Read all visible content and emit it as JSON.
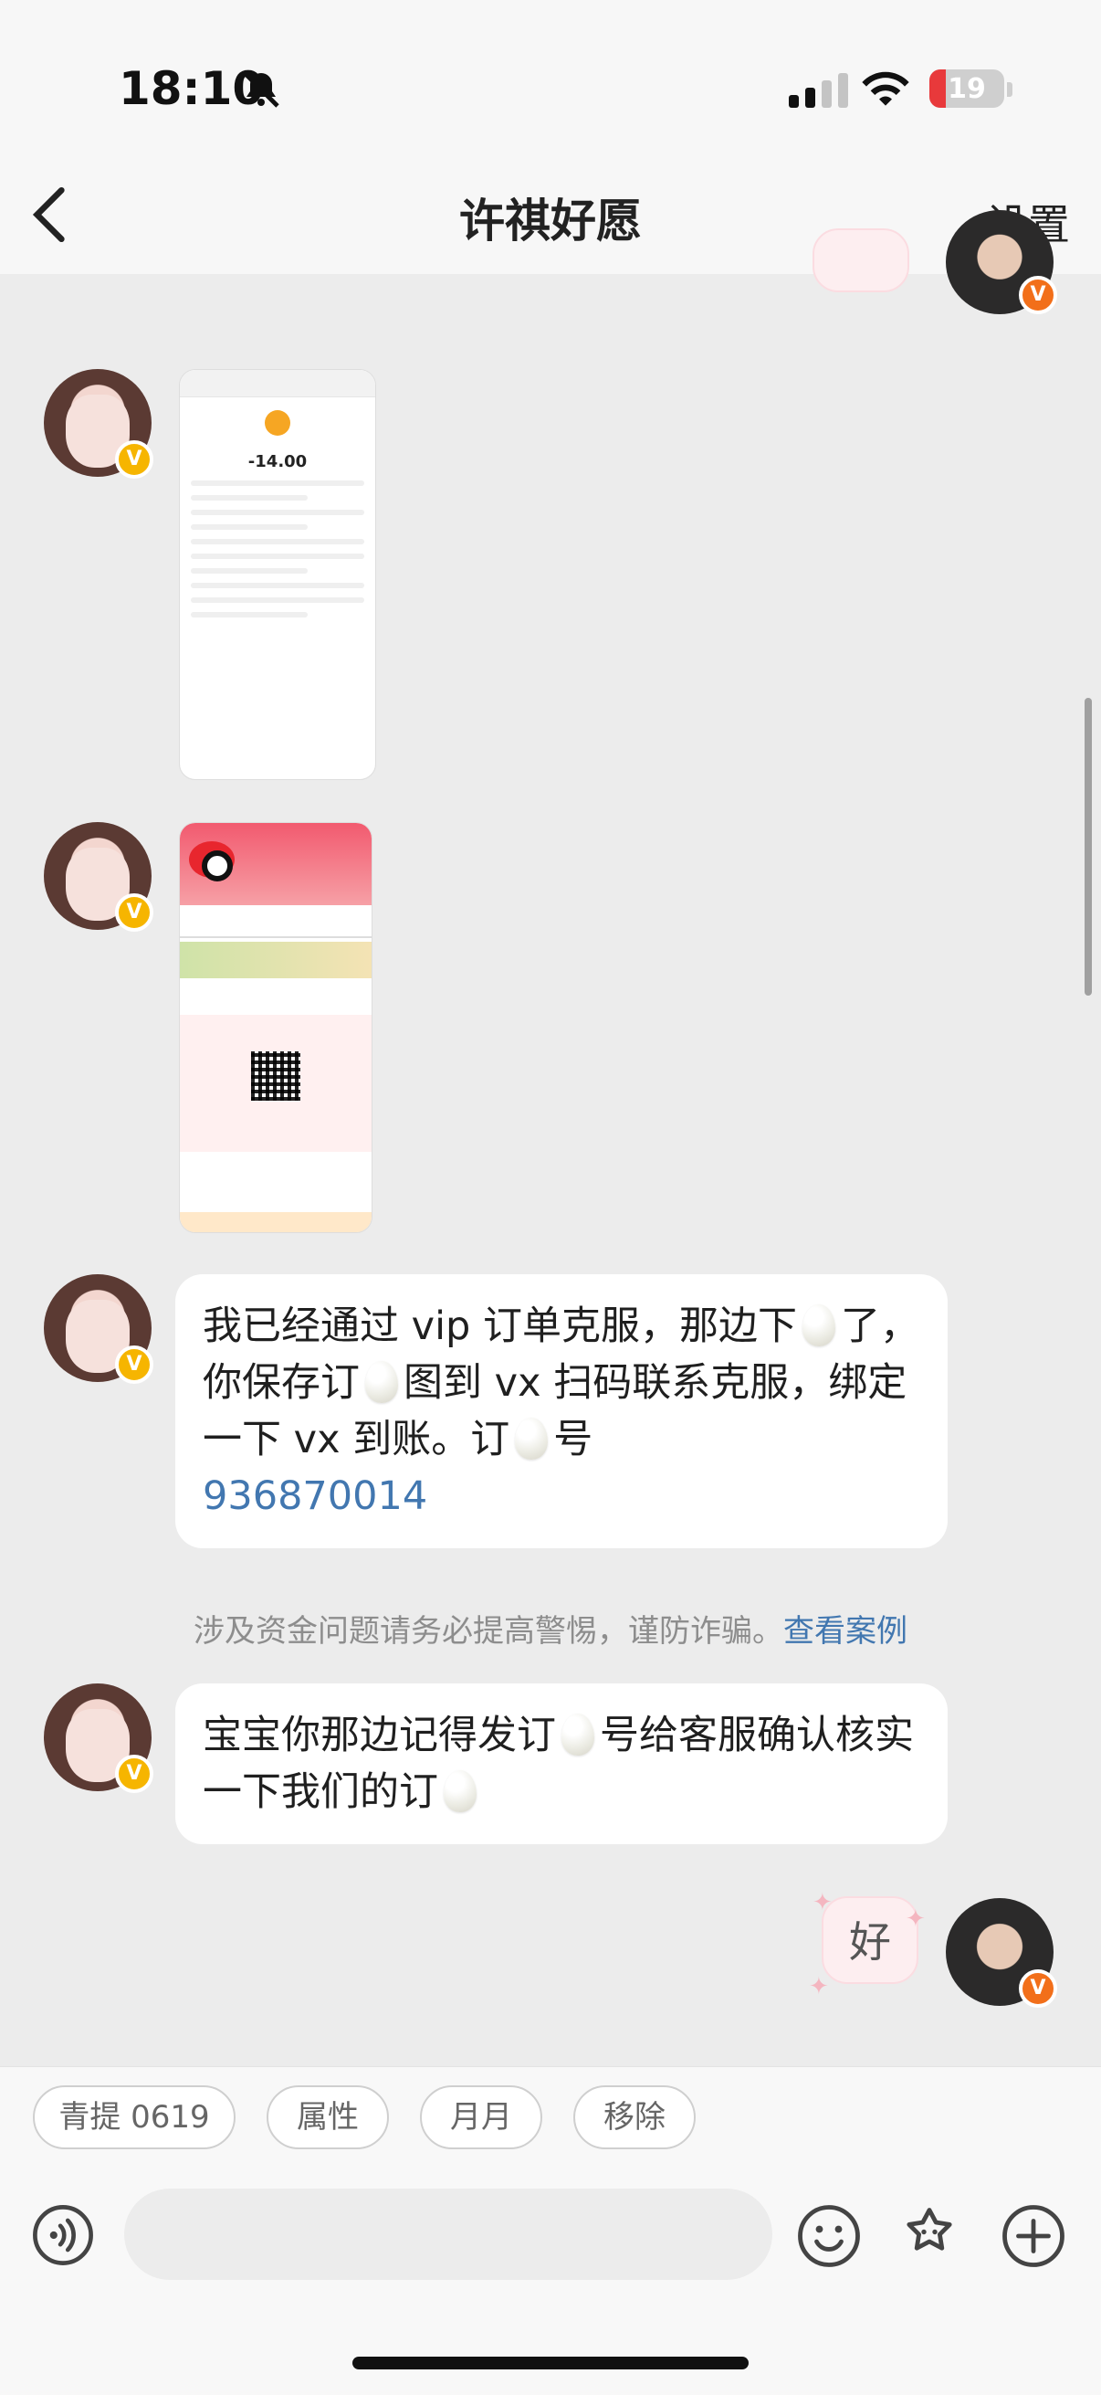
{
  "status_bar": {
    "time": "18:10",
    "battery": "19",
    "battery_color": "#e8393b",
    "icons": [
      "bell-muted-icon",
      "signal-icon",
      "wifi-icon",
      "battery-icon"
    ]
  },
  "header": {
    "title": "许祺好愿",
    "settings_label": "设置",
    "back_icon": "chevron-left-icon"
  },
  "messages": {
    "receipt_image": {
      "amount": "-14.00"
    },
    "text1": {
      "parts": [
        "我已经通过 vip 订单克服，那边下",
        "了，你保存订",
        "图到 vx 扫码联系克服，绑定一下 vx 到账。订",
        "号"
      ],
      "order_number": "936870014"
    },
    "warning": {
      "text": "涉及资金问题请务必提高警惕，谨防诈骗。",
      "link": "查看案例"
    },
    "text2": {
      "parts": [
        "宝宝你那边记得发订",
        "号给客服确认核实一下我们的订"
      ]
    },
    "reply_sticker": "好"
  },
  "quick_chips": [
    "青提 0619",
    "属性",
    "月月",
    "移除"
  ],
  "input_bar": {
    "placeholder": "",
    "icons": [
      "voice-icon",
      "emoji-icon",
      "sticker-icon",
      "add-icon"
    ]
  },
  "colors": {
    "accent_link": "#4277b0",
    "badge_yellow": "#f6b500",
    "badge_orange": "#f26f1a"
  }
}
